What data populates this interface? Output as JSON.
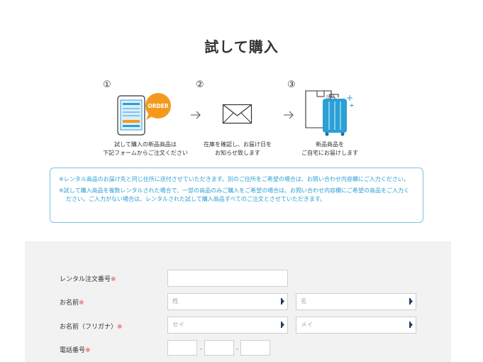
{
  "page": {
    "title": "試して購入"
  },
  "steps": [
    {
      "num": "①",
      "caption_line1": "試して購入の新品商品は",
      "caption_line2": "下記フォームからご注文ください",
      "badge": "ORDER"
    },
    {
      "num": "②",
      "caption_line1": "在庫を確認し、お届け日を",
      "caption_line2": "お知らせ致します"
    },
    {
      "num": "③",
      "caption_line1": "新品商品を",
      "caption_line2": "ご自宅にお届けします"
    }
  ],
  "notice": {
    "line1": "※レンタル商品のお届け先と同じ住所に送付させていただきます。別のご住所をご希望の場合は、お問い合わせ内容欄にご入力ください。",
    "line2": "※試して購入商品を複数レンタルされた場合で、一部の商品のみご購入をご希望の場合は、お問い合わせ内容欄にご希望の商品をご入力ください。ご入力がない場合は、レンタルされた試して購入商品すべてのご注文とさせていただきます。"
  },
  "form": {
    "required_mark": "※",
    "order_number": {
      "label": "レンタル注文番号",
      "value": ""
    },
    "name": {
      "label": "お名前",
      "last_placeholder": "姓",
      "first_placeholder": "名"
    },
    "kana": {
      "label": "お名前（フリガナ）",
      "last_placeholder": "セイ",
      "first_placeholder": "メイ"
    },
    "phone": {
      "label": "電話番号",
      "separator": "-"
    }
  },
  "colors": {
    "accent": "#2aa0d5",
    "required": "#e0393e",
    "order_badge": "#f39a1e",
    "panel_bg": "#f2f2f2"
  }
}
